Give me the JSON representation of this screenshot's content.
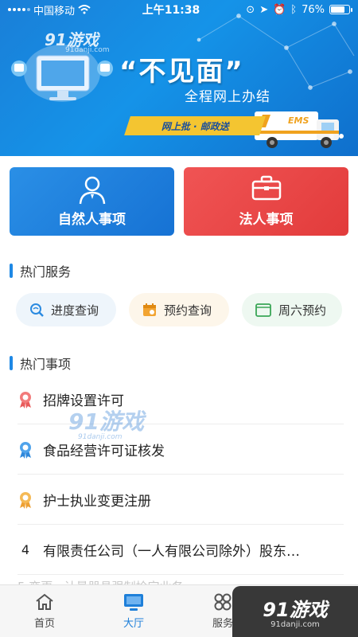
{
  "status_bar": {
    "carrier": "中国移动",
    "time": "上午11:38",
    "battery": "76%",
    "battery_level": 0.76
  },
  "banner": {
    "watermark": "91游戏",
    "watermark_sub": "91danji.com",
    "title": "“不见面”",
    "subtitle": "全程网上办结",
    "tape_text": "网上批 · 邮政送",
    "truck_label": "EMS"
  },
  "entries": [
    {
      "label": "自然人事项",
      "icon": "person-icon",
      "color": "#1f80de"
    },
    {
      "label": "法人事项",
      "icon": "briefcase-icon",
      "color": "#e84444"
    }
  ],
  "hot_services": {
    "title": "热门服务",
    "items": [
      {
        "label": "进度查询",
        "icon": "progress-search-icon"
      },
      {
        "label": "预约查询",
        "icon": "calendar-icon"
      },
      {
        "label": "周六预约",
        "icon": "saturday-calendar-icon",
        "badge": "周六"
      }
    ]
  },
  "hot_matters": {
    "title": "热门事项",
    "items": [
      {
        "label": "招牌设置许可",
        "medal": "red"
      },
      {
        "label": "食品经营许可证核发",
        "medal": "blue"
      },
      {
        "label": "护士执业变更注册",
        "medal": "orange"
      },
      {
        "num": "4",
        "label": "有限责任公司（一人有限公司除外）股东…"
      }
    ]
  },
  "faded_row": "5 变更 · 计量器具强制检定业务",
  "list_watermark": "91游戏",
  "list_watermark_sub": "91danji.com",
  "tabs": [
    {
      "label": "首页",
      "icon": "home-icon",
      "active": false
    },
    {
      "label": "大厅",
      "icon": "monitor-icon",
      "active": true
    },
    {
      "label": "服务",
      "icon": "grid-icon",
      "active": false
    }
  ],
  "brand_watermark": {
    "name": "91游戏",
    "site": "91danji.com"
  },
  "colors": {
    "accent": "#1e88e5",
    "banner": "#1593e8",
    "red_card": "#e84444"
  }
}
